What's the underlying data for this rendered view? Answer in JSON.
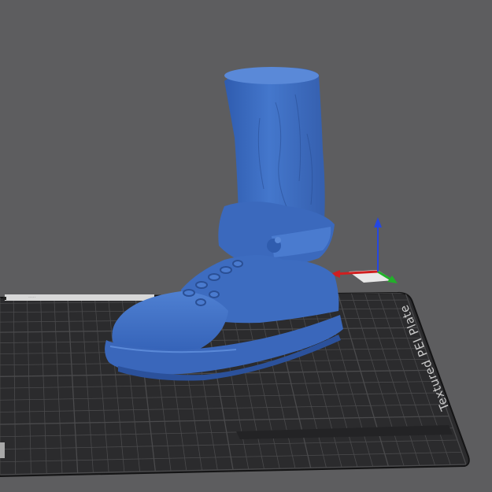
{
  "viewport": {
    "background_color": "#5d5d5f",
    "bed": {
      "label": "Textured PEI Plate",
      "surface_color": "#2b2b2d",
      "grid_color": "#4a4a4c",
      "edge_color": "#141415"
    },
    "model": {
      "color": "#3f6fc4",
      "shadow_color": "#2a4f95",
      "highlight_color": "#5a89d8"
    },
    "axes": {
      "x_color": "#d01f1f",
      "y_color": "#22b02a",
      "z_color": "#2547e0"
    }
  }
}
